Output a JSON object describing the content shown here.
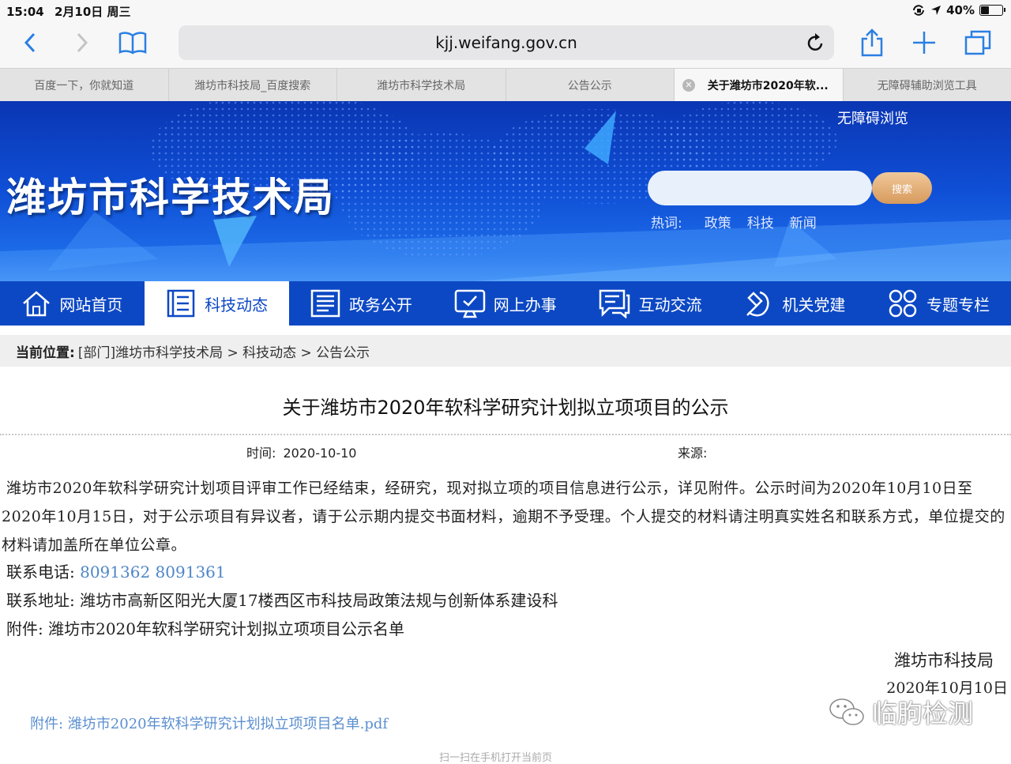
{
  "status_bar": {
    "time": "15:04",
    "date": "2月10日 周三",
    "battery": "40%",
    "battery_level": 0.4
  },
  "toolbar": {
    "url": "kjj.weifang.gov.cn"
  },
  "tabs": [
    {
      "label": "百度一下，你就知道",
      "active": false
    },
    {
      "label": "潍坊市科技局_百度搜索",
      "active": false
    },
    {
      "label": "潍坊市科学技术局",
      "active": false
    },
    {
      "label": "公告公示",
      "active": false
    },
    {
      "label": "关于潍坊市2020年软...",
      "active": true
    },
    {
      "label": "无障碍辅助浏览工具",
      "active": false
    }
  ],
  "banner": {
    "site_title": "潍坊市科学技术局",
    "accessibility_link": "无障碍浏览",
    "search_button": "搜索",
    "hotwords_label": "热词:",
    "hotwords": [
      "政策",
      "科技",
      "新闻"
    ]
  },
  "nav": [
    {
      "label": "网站首页",
      "icon": "home-icon"
    },
    {
      "label": "科技动态",
      "icon": "document-list-icon",
      "active": true
    },
    {
      "label": "政务公开",
      "icon": "file-text-icon"
    },
    {
      "label": "网上办事",
      "icon": "monitor-icon"
    },
    {
      "label": "互动交流",
      "icon": "chat-bubble-icon"
    },
    {
      "label": "机关党建",
      "icon": "party-emblem-icon"
    },
    {
      "label": "专题专栏",
      "icon": "grid-circles-icon"
    }
  ],
  "breadcrumb": {
    "label": "当前位置:",
    "path": "[部门]潍坊市科学技术局 > 科技动态 > 公告公示"
  },
  "article": {
    "title": "关于潍坊市2020年软科学研究计划拟立项项目的公示",
    "time_label": "时间:",
    "time_value": "2020-10-10",
    "source_label": "来源:",
    "body": "潍坊市2020年软科学研究计划项目评审工作已经结束，经研究，现对拟立项的项目信息进行公示，详见附件。公示时间为2020年10月10日至2020年10月15日，对于公示项目有异议者，请于公示期内提交书面材料，逾期不予受理。个人提交的材料请注明真实姓名和联系方式，单位提交的材料请加盖所在单位公章。",
    "phone_label": "联系电话:",
    "phone_value": "8091362 8091361",
    "address_label": "联系地址:",
    "address_value": "潍坊市高新区阳光大厦17楼西区市科技局政策法规与创新体系建设科",
    "attachment_label": "附件:",
    "attachment_value": "潍坊市2020年软科学研究计划拟立项项目公示名单",
    "signature_org": "潍坊市科技局",
    "signature_date": "2020年10月10日",
    "attachment_link_label": "附件:",
    "attachment_link_text": "潍坊市2020年软科学研究计划拟立项项目名单.pdf"
  },
  "watermark": {
    "text": "临朐检测"
  },
  "footer_cut_text": "扫一扫在手机打开当前页"
}
